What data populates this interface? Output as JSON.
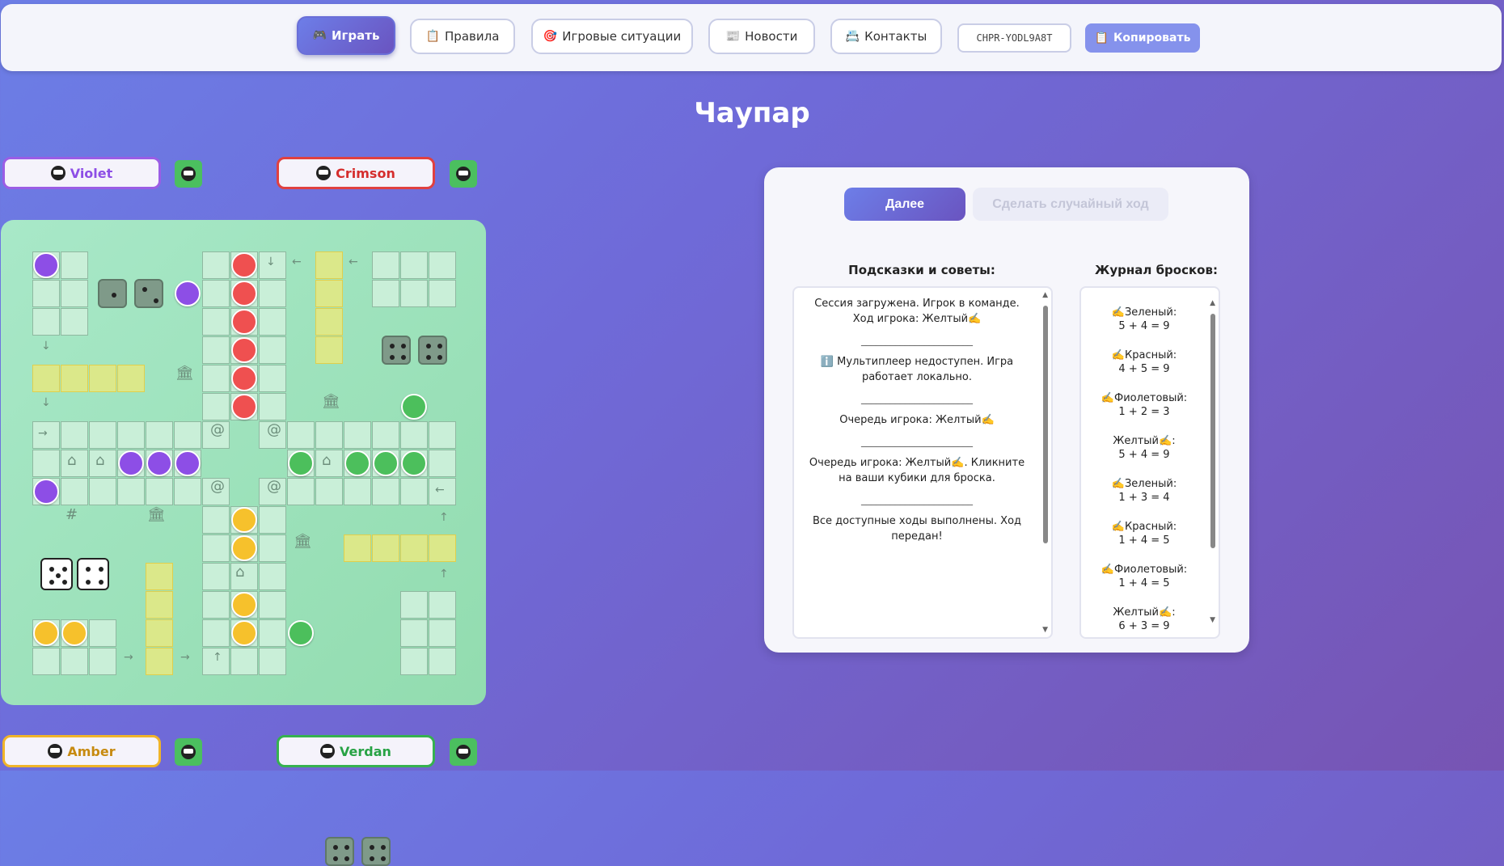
{
  "nav": {
    "play": {
      "icon": "🎮",
      "label": "Играть"
    },
    "rules": {
      "icon": "📋",
      "label": "Правила"
    },
    "situations": {
      "icon": "🎯",
      "label": "Игровые ситуации"
    },
    "news": {
      "icon": "📰",
      "label": "Новости"
    },
    "contacts": {
      "icon": "📇",
      "label": "Контакты"
    },
    "session_code": "CHPR-YODL9A8T",
    "copy": {
      "icon": "📋",
      "label": "Копировать"
    }
  },
  "title": "Чаупар",
  "players": {
    "violet": {
      "name": "Violet",
      "color": "#8d4ee6"
    },
    "crimson": {
      "name": "Crimson",
      "color": "#d52d2d"
    },
    "amber": {
      "name": "Amber",
      "color": "#c78a10"
    },
    "verdan": {
      "name": "Verdan",
      "color": "#27a244"
    }
  },
  "controls": {
    "next": "Далее",
    "random_move": "Сделать случайный ход"
  },
  "hints": {
    "title": "Подсказки и советы:",
    "separator": "_______________________",
    "items": [
      "Сессия загружена. Игрок в команде. Ход игрока: Желтый✍️",
      "ℹ️ Мультиплеер недоступен. Игра работает локально.",
      "Очередь игрока: Желтый✍️",
      "Очередь игрока: Желтый✍️. Кликните на ваши кубики для броска.",
      "Все доступные ходы выполнены. Ход передан!"
    ]
  },
  "rolls": {
    "title": "Журнал бросков:",
    "items": [
      {
        "player": "✍️Зеленый:",
        "calc": "5 + 4 = 9"
      },
      {
        "player": "✍️Красный:",
        "calc": "4 + 5 = 9"
      },
      {
        "player": "✍️Фиолетовый:",
        "calc": "1 + 2 = 3"
      },
      {
        "player": "Желтый✍️:",
        "calc": "5 + 4 = 9"
      },
      {
        "player": "✍️Зеленый:",
        "calc": "1 + 3 = 4"
      },
      {
        "player": "✍️Красный:",
        "calc": "1 + 4 = 5"
      },
      {
        "player": "✍️Фиолетовый:",
        "calc": "1 + 4 = 5"
      },
      {
        "player": "Желтый✍️:",
        "calc": "6 + 3 = 9"
      }
    ]
  }
}
